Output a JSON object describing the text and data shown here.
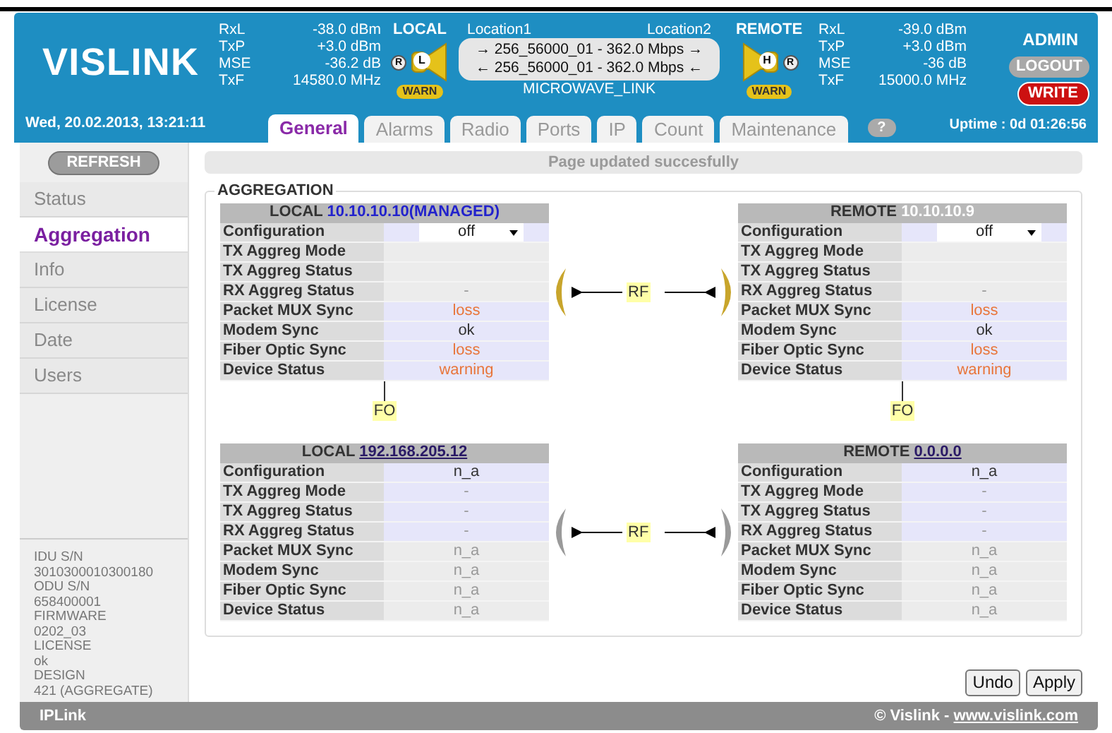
{
  "header": {
    "logo": "VISLINK",
    "local": {
      "title": "LOCAL",
      "stats": [
        {
          "name": "RxL",
          "value": "-38.0 dBm"
        },
        {
          "name": "TxP",
          "value": "+3.0 dBm"
        },
        {
          "name": "MSE",
          "value": "-36.2 dB"
        },
        {
          "name": "TxF",
          "value": "14580.0 MHz"
        }
      ],
      "indicator": "R",
      "antenna_letter": "L",
      "badge": "WARN"
    },
    "link": {
      "location1": "Location1",
      "location2": "Location2",
      "lines": [
        "→ 256_56000_01 - 362.0 Mbps →",
        "← 256_56000_01 - 362.0 Mbps ←"
      ],
      "name": "MICROWAVE_LINK"
    },
    "remote": {
      "title": "REMOTE",
      "stats": [
        {
          "name": "RxL",
          "value": "-39.0 dBm"
        },
        {
          "name": "TxP",
          "value": "+3.0 dBm"
        },
        {
          "name": "MSE",
          "value": "-36 dB"
        },
        {
          "name": "TxF",
          "value": "15000.0 MHz"
        }
      ],
      "indicator": "R",
      "antenna_letter": "H",
      "badge": "WARN"
    },
    "user": "ADMIN",
    "logout": "LOGOUT",
    "write": "WRITE"
  },
  "date": "Wed, 20.02.2013, 13:21:11",
  "tabs": [
    {
      "label": "General",
      "selected": true
    },
    {
      "label": "Alarms",
      "selected": false
    },
    {
      "label": "Radio",
      "selected": false
    },
    {
      "label": "Ports",
      "selected": false
    },
    {
      "label": "IP",
      "selected": false
    },
    {
      "label": "Count",
      "selected": false
    },
    {
      "label": "Maintenance",
      "selected": false
    }
  ],
  "help": "?",
  "uptime": "Uptime : 0d 01:26:56",
  "sidebar": {
    "refresh": "REFRESH",
    "items": [
      {
        "label": "Status",
        "selected": false
      },
      {
        "label": "Aggregation",
        "selected": true
      },
      {
        "label": "Info",
        "selected": false
      },
      {
        "label": "License",
        "selected": false
      },
      {
        "label": "Date",
        "selected": false
      },
      {
        "label": "Users",
        "selected": false
      }
    ],
    "info": [
      {
        "label": "IDU S/N",
        "value": "3010300010300180"
      },
      {
        "label": "ODU S/N",
        "value": "658400001"
      },
      {
        "label": "FIRMWARE",
        "value": "0202_03"
      },
      {
        "label": "LICENSE",
        "value": "ok"
      },
      {
        "label": "DESIGN",
        "value": "421 (AGGREGATE)"
      }
    ]
  },
  "message": "Page updated succesfully",
  "aggregation": {
    "title": "AGGREGATION",
    "pairs": [
      {
        "local": {
          "title": "LOCAL",
          "address": "10.10.10.10",
          "address_suffix": "(MANAGED)",
          "address_link": false,
          "address_faded": false,
          "rows": [
            {
              "label": "Configuration",
              "kind": "select",
              "value": "off",
              "highlighted": true
            },
            {
              "label": "TX Aggreg Mode",
              "kind": "text",
              "highlighted": false
            },
            {
              "label": "TX Aggreg Status",
              "kind": "text",
              "highlighted": false
            },
            {
              "label": "RX Aggreg Status",
              "kind": "text",
              "value": "-",
              "alert": false,
              "muted": true,
              "highlighted": false
            },
            {
              "label": "Packet MUX Sync",
              "kind": "text",
              "value": "loss",
              "alert": true,
              "muted": false,
              "highlighted": true
            },
            {
              "label": "Modem Sync",
              "kind": "text",
              "value": "ok",
              "alert": false,
              "muted": false,
              "highlighted": true
            },
            {
              "label": "Fiber Optic Sync",
              "kind": "text",
              "value": "loss",
              "alert": true,
              "muted": false,
              "highlighted": true
            },
            {
              "label": "Device Status",
              "kind": "text",
              "value": "warning",
              "alert": true,
              "muted": false,
              "highlighted": true
            }
          ]
        },
        "link": {
          "label": "RF",
          "color": "#c8a52c"
        },
        "remote": {
          "title": "REMOTE",
          "address": "10.10.10.9",
          "address_link": false,
          "address_faded": true,
          "rows": [
            {
              "label": "Configuration",
              "kind": "select",
              "value": "off",
              "highlighted": true
            },
            {
              "label": "TX Aggreg Mode",
              "kind": "text",
              "highlighted": false
            },
            {
              "label": "TX Aggreg Status",
              "kind": "text",
              "highlighted": false
            },
            {
              "label": "RX Aggreg Status",
              "kind": "text",
              "value": "-",
              "alert": false,
              "muted": true,
              "highlighted": false
            },
            {
              "label": "Packet MUX Sync",
              "kind": "text",
              "value": "loss",
              "alert": true,
              "muted": false,
              "highlighted": true
            },
            {
              "label": "Modem Sync",
              "kind": "text",
              "value": "ok",
              "alert": false,
              "muted": false,
              "highlighted": true
            },
            {
              "label": "Fiber Optic Sync",
              "kind": "text",
              "value": "loss",
              "alert": true,
              "muted": false,
              "highlighted": true
            },
            {
              "label": "Device Status",
              "kind": "text",
              "value": "warning",
              "alert": true,
              "muted": false,
              "highlighted": true
            }
          ]
        }
      },
      {
        "local": {
          "title": "LOCAL",
          "address": "192.168.205.12",
          "address_link": true,
          "address_faded": false,
          "rows": [
            {
              "label": "Configuration",
              "kind": "text",
              "value": "n_a",
              "alert": false,
              "muted": false,
              "highlighted": true
            },
            {
              "label": "TX Aggreg Mode",
              "kind": "text",
              "value": "-",
              "alert": false,
              "muted": true,
              "highlighted": true
            },
            {
              "label": "TX Aggreg Status",
              "kind": "text",
              "value": "-",
              "alert": false,
              "muted": true,
              "highlighted": true
            },
            {
              "label": "RX Aggreg Status",
              "kind": "text",
              "value": "-",
              "alert": false,
              "muted": true,
              "highlighted": true
            },
            {
              "label": "Packet MUX Sync",
              "kind": "text",
              "value": "n_a",
              "alert": false,
              "muted": true,
              "highlighted": false
            },
            {
              "label": "Modem Sync",
              "kind": "text",
              "value": "n_a",
              "alert": false,
              "muted": true,
              "highlighted": false
            },
            {
              "label": "Fiber Optic Sync",
              "kind": "text",
              "value": "n_a",
              "alert": false,
              "muted": true,
              "highlighted": false
            },
            {
              "label": "Device Status",
              "kind": "text",
              "value": "n_a",
              "alert": false,
              "muted": true,
              "highlighted": false
            }
          ]
        },
        "link": {
          "label": "RF",
          "color": "#9a9a9a"
        },
        "remote": {
          "title": "REMOTE",
          "address": "0.0.0.0",
          "address_link": true,
          "address_faded": false,
          "rows": [
            {
              "label": "Configuration",
              "kind": "text",
              "value": "n_a",
              "alert": false,
              "muted": false,
              "highlighted": true
            },
            {
              "label": "TX Aggreg Mode",
              "kind": "text",
              "value": "-",
              "alert": false,
              "muted": true,
              "highlighted": true
            },
            {
              "label": "TX Aggreg Status",
              "kind": "text",
              "value": "-",
              "alert": false,
              "muted": true,
              "highlighted": true
            },
            {
              "label": "RX Aggreg Status",
              "kind": "text",
              "value": "-",
              "alert": false,
              "muted": true,
              "highlighted": true
            },
            {
              "label": "Packet MUX Sync",
              "kind": "text",
              "value": "n_a",
              "alert": false,
              "muted": true,
              "highlighted": false
            },
            {
              "label": "Modem Sync",
              "kind": "text",
              "value": "n_a",
              "alert": false,
              "muted": true,
              "highlighted": false
            },
            {
              "label": "Fiber Optic Sync",
              "kind": "text",
              "value": "n_a",
              "alert": false,
              "muted": true,
              "highlighted": false
            },
            {
              "label": "Device Status",
              "kind": "text",
              "value": "n_a",
              "alert": false,
              "muted": true,
              "highlighted": false
            }
          ]
        }
      }
    ],
    "fo_links": [
      "FO",
      "FO"
    ]
  },
  "buttons": [
    "Undo",
    "Apply"
  ],
  "footer": {
    "left": "IPLink",
    "copyright": "© Vislink - ",
    "link": "www.vislink.com"
  }
}
